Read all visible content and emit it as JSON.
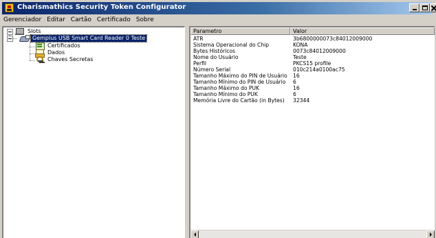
{
  "window": {
    "title": "Charismathics Security Token Configurator",
    "colors": {
      "titlebar_start": "#0a246a",
      "titlebar_end": "#a6caf0",
      "face": "#d4d0c8",
      "selection": "#0a246a"
    },
    "controls": {
      "minimize_icon": "minimize-icon",
      "maximize_icon": "maximize-icon",
      "close_icon": "close-icon"
    }
  },
  "menubar": {
    "items": [
      "Gerenciador",
      "Editar",
      "Cartão",
      "Certificado",
      "Sobre"
    ]
  },
  "tree": {
    "root": {
      "label": "Slots",
      "icon": "computer-icon",
      "expanded": true
    },
    "reader": {
      "label": "Gemplus USB Smart Card Reader 0 Teste",
      "icon": "card-reader-icon",
      "expanded": true,
      "selected": true
    },
    "children": [
      {
        "label": "Certificados",
        "icon": "certificate-icon"
      },
      {
        "label": "Dados",
        "icon": "data-icon"
      },
      {
        "label": "Chaves Secretas",
        "icon": "keys-icon"
      }
    ]
  },
  "details": {
    "columns": [
      "Parametro",
      "Valor"
    ],
    "rows": [
      [
        "ATR",
        "3b6800000073c84012009000"
      ],
      [
        "Sistema Operacional do Chip",
        "KONA"
      ],
      [
        "Bytes Históricos",
        "0073c84012009000"
      ],
      [
        "Nome do Usuário",
        "Teste"
      ],
      [
        "Perfil",
        "PKCS15 profile"
      ],
      [
        "Número Serial",
        "010c214a0100ac75"
      ],
      [
        "Tamanho Máximo do PIN de Usuário",
        "16"
      ],
      [
        "Tamanho Mínimo do PIN de Usuário",
        "6"
      ],
      [
        "Tamanho Máximo do PUK",
        "16"
      ],
      [
        "Tamanho Mínimo do PUK",
        "6"
      ],
      [
        "Memória Livre do Cartão (in Bytes)",
        "32344"
      ]
    ]
  }
}
